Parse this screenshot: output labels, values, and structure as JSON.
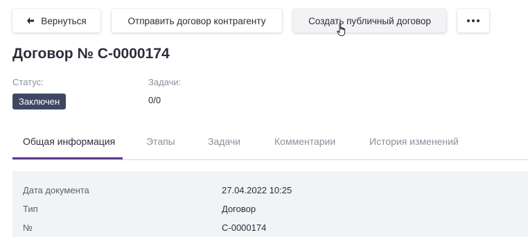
{
  "toolbar": {
    "back_label": "Вернуться",
    "send_label": "Отправить договор контрагенту",
    "create_label": "Создать публичный договор",
    "back_icon": "arrow-left-icon",
    "more_icon": "more-horizontal-icon"
  },
  "contract": {
    "title": "Договор № С-0000174",
    "status_label": "Статус:",
    "status_value": "Заключен",
    "tasks_label": "Задачи:",
    "tasks_value": "0/0"
  },
  "tabs": [
    {
      "label": "Общая информация",
      "active": true
    },
    {
      "label": "Этапы",
      "active": false
    },
    {
      "label": "Задачи",
      "active": false
    },
    {
      "label": "Комментарии",
      "active": false
    },
    {
      "label": "История изменений",
      "active": false
    }
  ],
  "info": [
    {
      "label": "Дата документа",
      "value": "27.04.2022 10:25"
    },
    {
      "label": "Тип",
      "value": "Договор"
    },
    {
      "label": "№",
      "value": "С-0000174"
    }
  ],
  "colors": {
    "accent": "#5b3b8c",
    "status_badge_bg": "#3f4763",
    "panel_bg": "#f2f3f5"
  }
}
